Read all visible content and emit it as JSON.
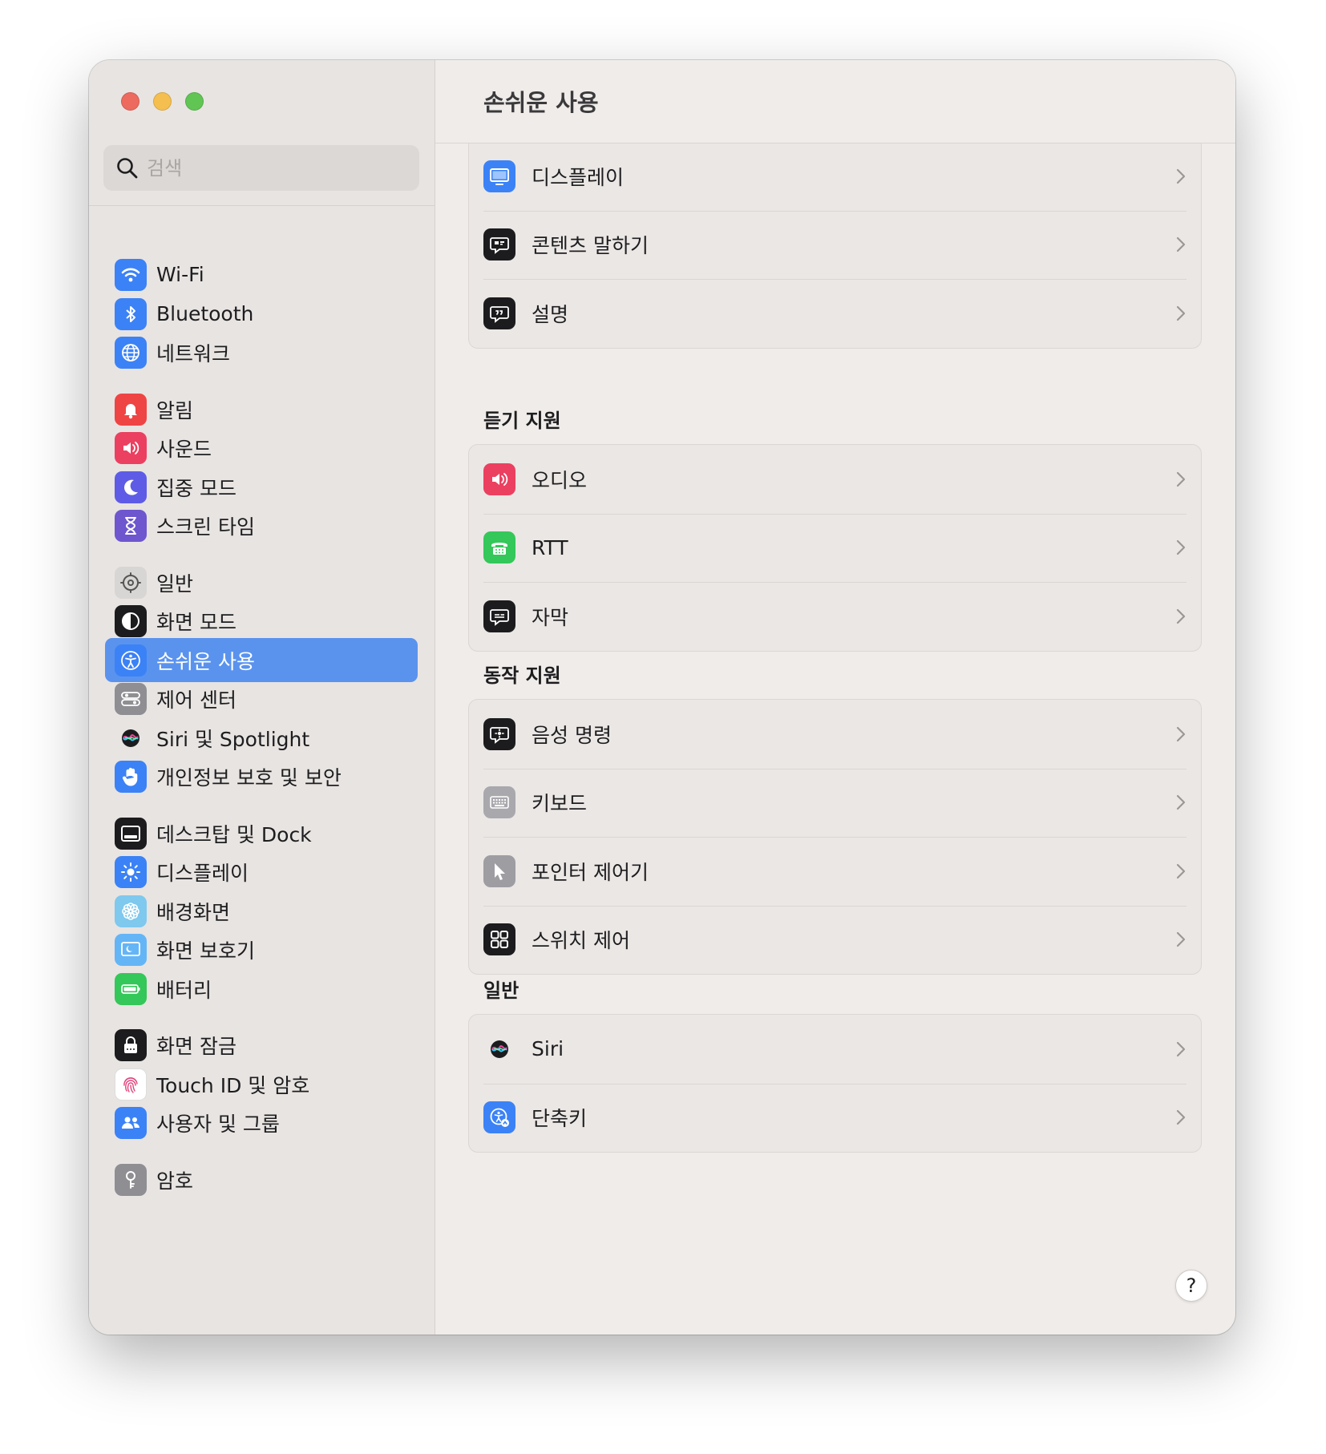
{
  "window": {
    "title": "손쉬운 사용",
    "controls": [
      "close",
      "minimize",
      "zoom"
    ]
  },
  "search": {
    "placeholder": "검색",
    "value": ""
  },
  "sidebar": {
    "items": [
      {
        "label": "Wi-Fi",
        "icon": "wifi-icon",
        "color": "#3b82f6"
      },
      {
        "label": "Bluetooth",
        "icon": "bluetooth-icon",
        "color": "#3b82f6"
      },
      {
        "label": "네트워크",
        "icon": "globe-icon",
        "color": "#3b82f6"
      },
      {
        "label": "알림",
        "icon": "bell-icon",
        "color": "#ef4444"
      },
      {
        "label": "사운드",
        "icon": "speaker-icon",
        "color": "#ec4060"
      },
      {
        "label": "집중 모드",
        "icon": "moon-icon",
        "color": "#5e5ce6"
      },
      {
        "label": "스크린 타임",
        "icon": "hourglass-icon",
        "color": "#6e56cf"
      },
      {
        "label": "일반",
        "icon": "gear-icon",
        "color": "#8e8e93"
      },
      {
        "label": "화면 모드",
        "icon": "appearance-icon",
        "color": "#1c1c1e"
      },
      {
        "label": "손쉬운 사용",
        "icon": "accessibility-icon",
        "color": "#3b82f6",
        "selected": true
      },
      {
        "label": "제어 센터",
        "icon": "control-center-icon",
        "color": "#8e8e93"
      },
      {
        "label": "Siri 및 Spotlight",
        "icon": "siri-icon",
        "color": "#1c1c1e"
      },
      {
        "label": "개인정보 보호 및 보안",
        "icon": "hand-icon",
        "color": "#3b82f6"
      },
      {
        "label": "데스크탑 및 Dock",
        "icon": "dock-icon",
        "color": "#1c1c1e"
      },
      {
        "label": "디스플레이",
        "icon": "sun-icon",
        "color": "#3b82f6"
      },
      {
        "label": "배경화면",
        "icon": "flower-icon",
        "color": "#5ac8fa"
      },
      {
        "label": "화면 보호기",
        "icon": "screensaver-icon",
        "color": "#64b5f6"
      },
      {
        "label": "배터리",
        "icon": "battery-icon",
        "color": "#34c759"
      },
      {
        "label": "화면 잠금",
        "icon": "lock-icon",
        "color": "#1c1c1e"
      },
      {
        "label": "Touch ID 및 암호",
        "icon": "fingerprint-icon",
        "color": "#ffffff"
      },
      {
        "label": "사용자 및 그룹",
        "icon": "users-icon",
        "color": "#3b82f6"
      },
      {
        "label": "암호",
        "icon": "key-icon",
        "color": "#8e8e93"
      }
    ]
  },
  "main": {
    "groups": [
      {
        "title": "",
        "rows": [
          {
            "label": "디스플레이",
            "icon": "display-icon",
            "color": "#3b82f6"
          },
          {
            "label": "콘텐츠 말하기",
            "icon": "speech-bubble-icon",
            "color": "#1c1c1e"
          },
          {
            "label": "설명",
            "icon": "quote-bubble-icon",
            "color": "#1c1c1e"
          }
        ]
      },
      {
        "title": "듣기 지원",
        "rows": [
          {
            "label": "오디오",
            "icon": "speaker-icon",
            "color": "#ec4060"
          },
          {
            "label": "RTT",
            "icon": "tty-icon",
            "color": "#34c759"
          },
          {
            "label": "자막",
            "icon": "captions-icon",
            "color": "#1c1c1e"
          }
        ]
      },
      {
        "title": "동작 지원",
        "rows": [
          {
            "label": "음성 명령",
            "icon": "voice-control-icon",
            "color": "#1c1c1e"
          },
          {
            "label": "키보드",
            "icon": "keyboard-icon",
            "color": "#8e8e93"
          },
          {
            "label": "포인터 제어기",
            "icon": "pointer-icon",
            "color": "#8e8e93"
          },
          {
            "label": "스위치 제어",
            "icon": "switch-control-icon",
            "color": "#1c1c1e"
          }
        ]
      },
      {
        "title": "일반",
        "rows": [
          {
            "label": "Siri",
            "icon": "siri-icon",
            "color": "#1c1c1e"
          },
          {
            "label": "단축키",
            "icon": "accessibility-shortcut-icon",
            "color": "#3b82f6"
          }
        ]
      }
    ]
  },
  "help": {
    "label": "?"
  }
}
